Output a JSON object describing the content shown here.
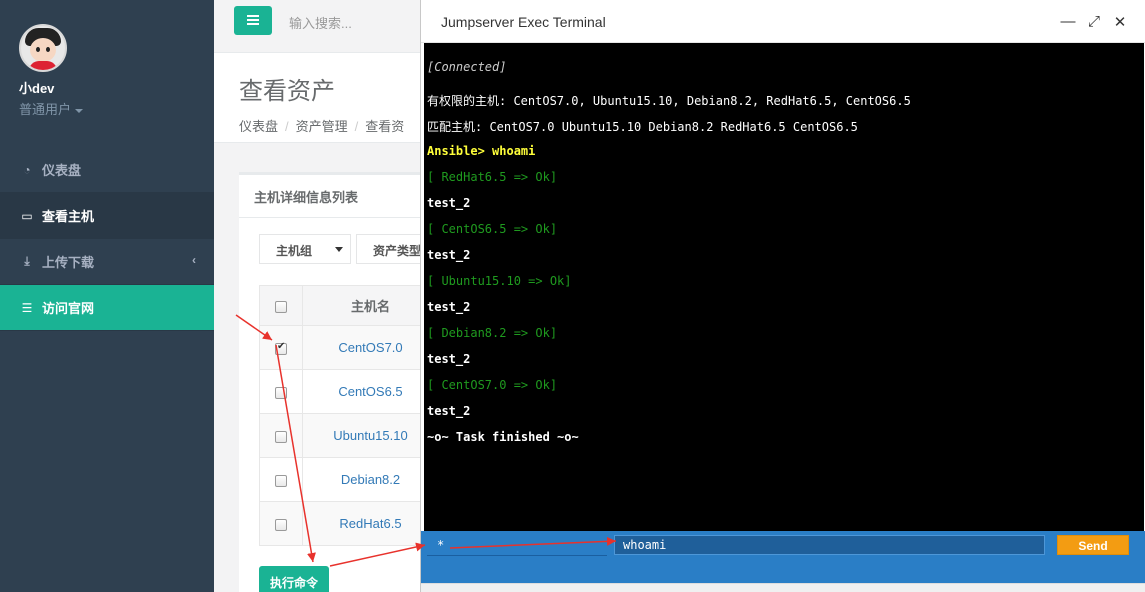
{
  "user": {
    "name": "小dev",
    "role": "普通用户"
  },
  "sidebar": {
    "items": [
      {
        "label": "仪表盘",
        "icon": "dashboard-icon"
      },
      {
        "label": "查看主机",
        "icon": "desktop-icon"
      },
      {
        "label": "上传下载",
        "icon": "download-icon"
      },
      {
        "label": "访问官网",
        "icon": "database-icon"
      }
    ]
  },
  "topbar": {
    "search_placeholder": "输入搜索..."
  },
  "page": {
    "title": "查看资产",
    "breadcrumbs": [
      "仪表盘",
      "资产管理",
      "查看资"
    ]
  },
  "panel": {
    "title": "主机详细信息列表",
    "filter_group": "主机组",
    "filter_type": "资产类型",
    "column_name": "主机名",
    "rows": [
      {
        "name": "CentOS7.0",
        "checked": true
      },
      {
        "name": "CentOS6.5",
        "checked": false
      },
      {
        "name": "Ubuntu15.10",
        "checked": false
      },
      {
        "name": "Debian8.2",
        "checked": false
      },
      {
        "name": "RedHat6.5",
        "checked": false
      }
    ],
    "exec_button": "执行命令"
  },
  "terminal": {
    "title": "Jumpserver Exec Terminal",
    "lines": {
      "connected": "[Connected]",
      "allowed": "有权限的主机: CentOS7.0, Ubuntu15.10, Debian8.2, RedHat6.5, CentOS6.5",
      "matched": "匹配主机: CentOS7.0 Ubuntu15.10 Debian8.2 RedHat6.5 CentOS6.5",
      "prompt": "Ansible> whoami",
      "r1": "[ RedHat6.5 => Ok]",
      "o1": "test_2",
      "r2": "[ CentOS6.5 => Ok]",
      "o2": "test_2",
      "r3": "[ Ubuntu15.10 => Ok]",
      "o3": "test_2",
      "r4": "[ Debian8.2 => Ok]",
      "o4": "test_2",
      "r5": "[ CentOS7.0 => Ok]",
      "o5": "test_2",
      "finished": "~o~ Task finished ~o~"
    },
    "host_pattern": "*",
    "command": "whoami",
    "send_label": "Send"
  },
  "colors": {
    "teal": "#1ab394",
    "sidebar": "#2f4050",
    "send": "#f39c12",
    "arrow": "#e8322c"
  }
}
